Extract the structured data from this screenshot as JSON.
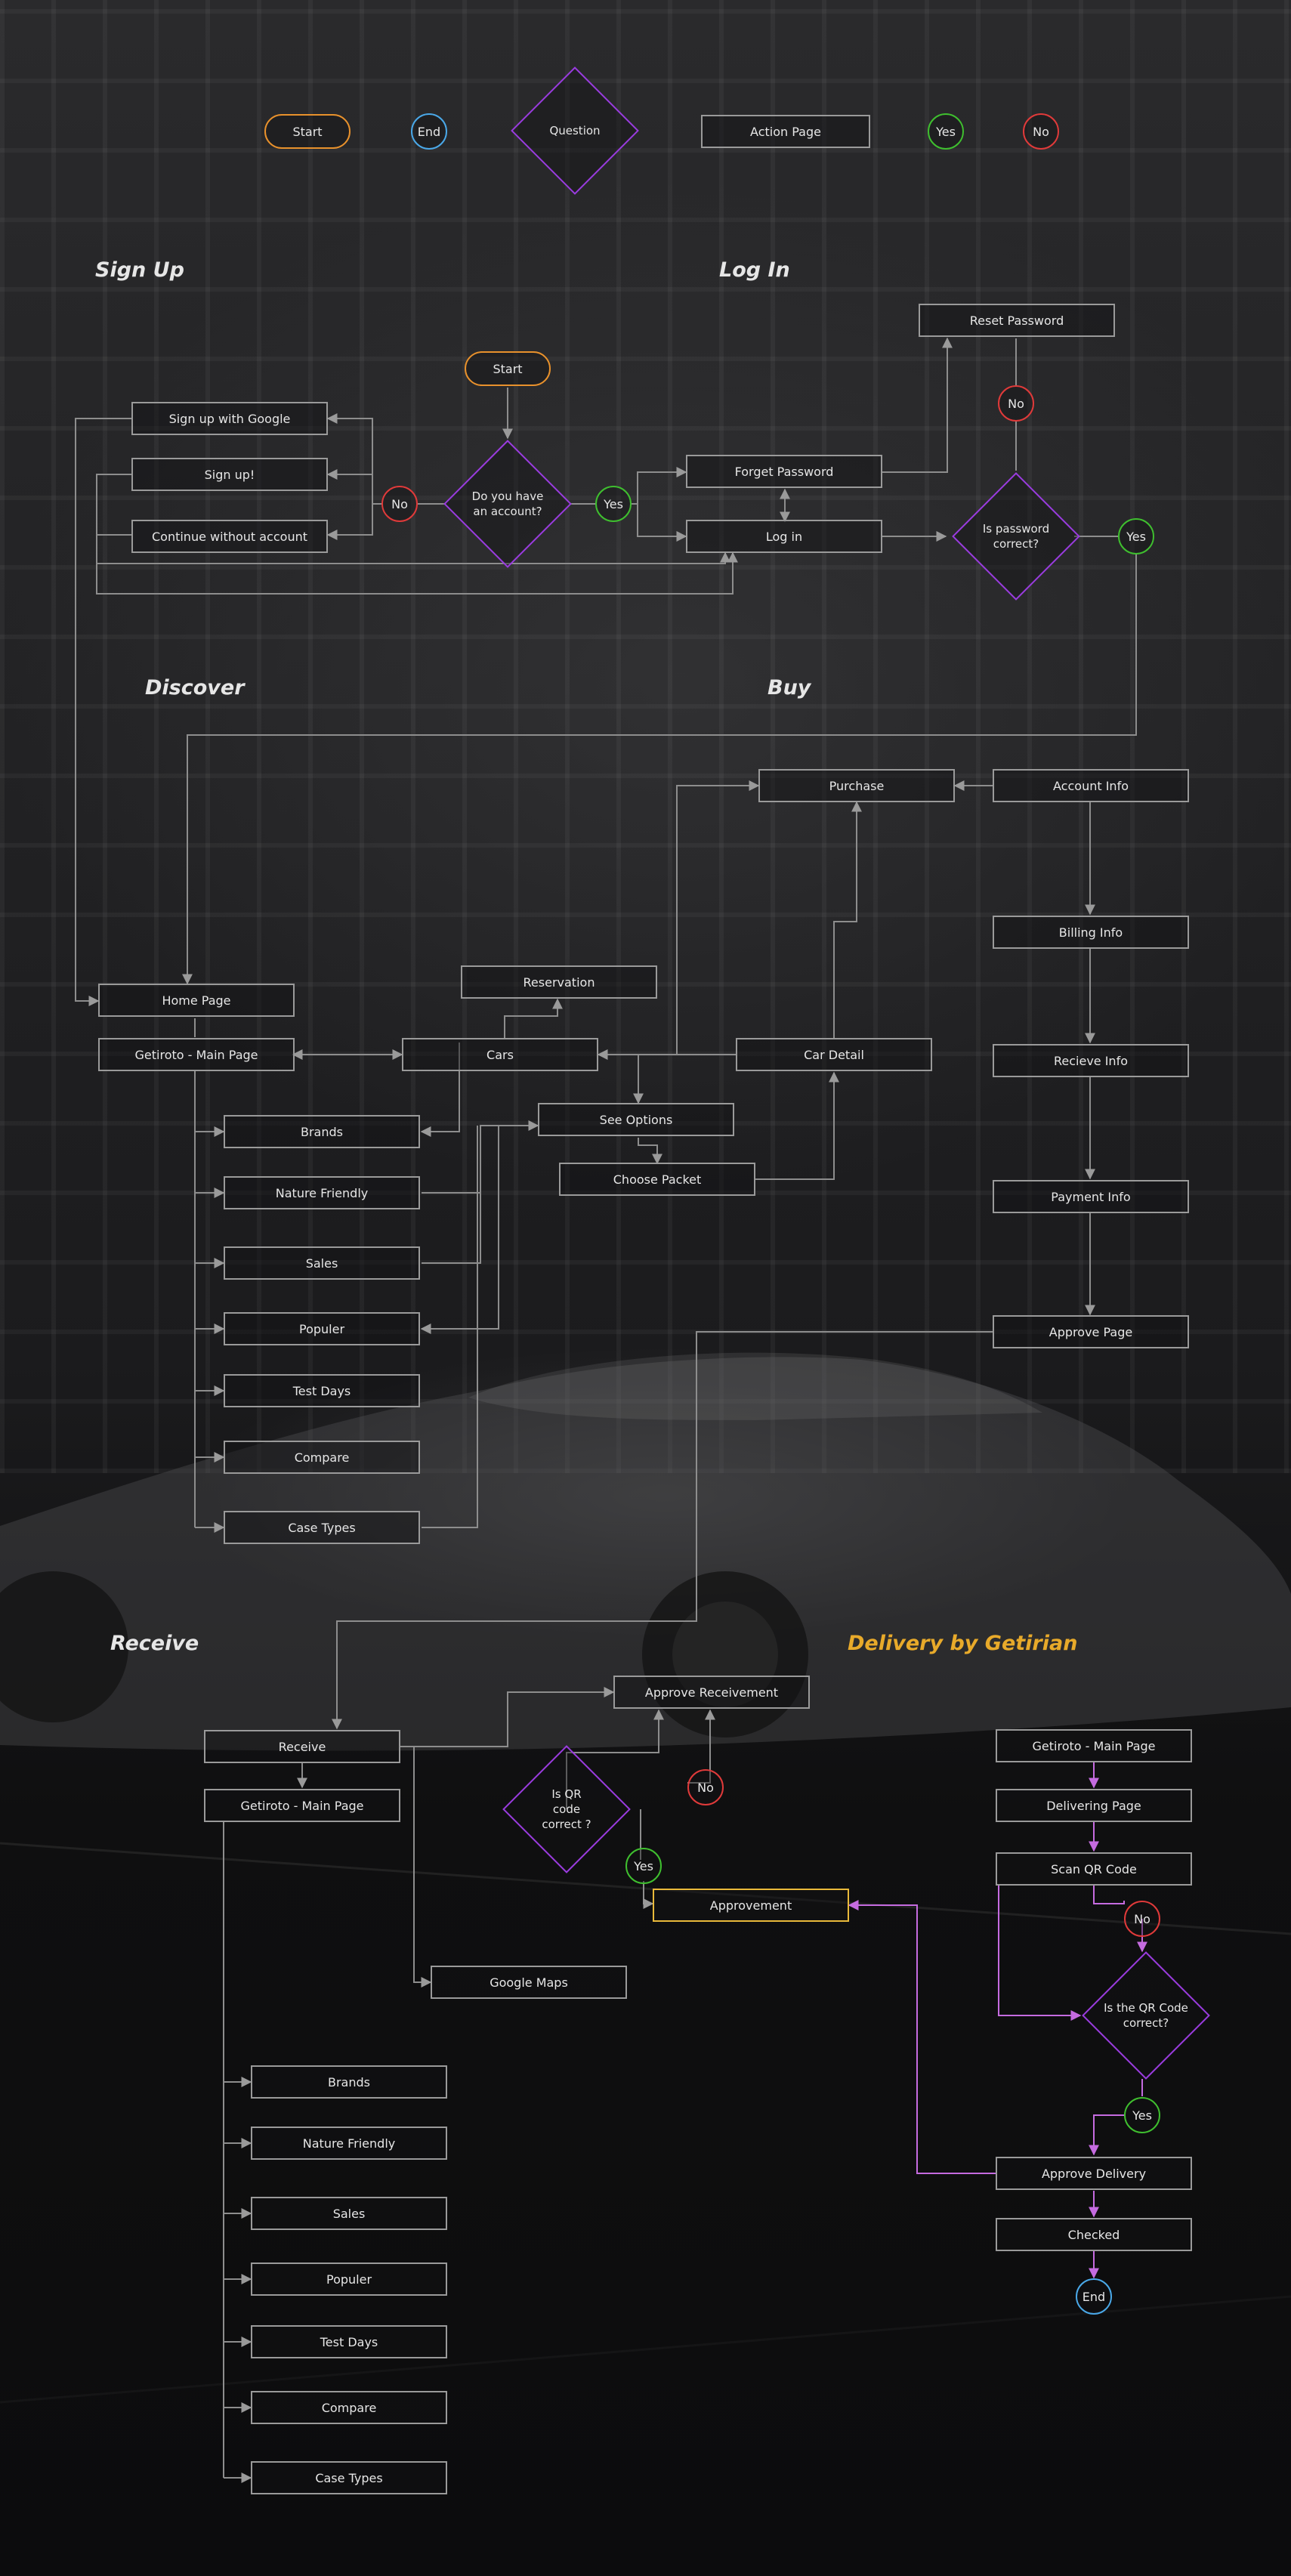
{
  "legend": {
    "start": "Start",
    "end": "End",
    "question": "Question",
    "action": "Action Page",
    "yes": "Yes",
    "no": "No"
  },
  "colors": {
    "start": "#e8912c",
    "end": "#4aa8e8",
    "question": "#9a3cdf",
    "yes": "#3fbf2f",
    "no": "#e03a3a",
    "highlight": "#e9b93a",
    "delivery_flow": "#c56be0",
    "connector": "#9a9a9a"
  },
  "sections": {
    "signup": "Sign Up",
    "login": "Log In",
    "discover": "Discover",
    "buy": "Buy",
    "receive": "Receive",
    "delivery": "Delivery by Getirian"
  },
  "auth": {
    "start": "Start",
    "question": "Do you have an account?",
    "no": "No",
    "yes": "Yes",
    "signup_google": "Sign up with Google",
    "signup": "Sign up!",
    "continue": "Continue without account",
    "forget": "Forget Password",
    "login": "Log in",
    "password_question": "Is password correct?",
    "reset": "Reset Password",
    "no2": "No",
    "yes2": "Yes"
  },
  "discover": {
    "home": "Home Page",
    "main": "Getiroto - Main Page",
    "cars": "Cars",
    "reservation": "Reservation",
    "see_options": "See Options",
    "choose_packet": "Choose Packet",
    "car_detail": "Car Detail",
    "list": [
      "Brands",
      "Nature Friendly",
      "Sales",
      "Populer",
      "Test Days",
      "Compare",
      "Case Types"
    ]
  },
  "buy": {
    "purchase": "Purchase",
    "account": "Account Info",
    "billing": "Billing Info",
    "recieve": "Recieve Info",
    "payment": "Payment Info",
    "approve": "Approve Page"
  },
  "receive": {
    "receive": "Receive",
    "main": "Getiroto - Main Page",
    "approve_receivement": "Approve Receivement",
    "qr_question": "Is QR code correct ?",
    "no": "No",
    "yes": "Yes",
    "approvement": "Approvement",
    "maps": "Google Maps",
    "list": [
      "Brands",
      "Nature Friendly",
      "Sales",
      "Populer",
      "Test Days",
      "Compare",
      "Case Types"
    ]
  },
  "delivery": {
    "main": "Getiroto - Main Page",
    "delivering": "Delivering Page",
    "scan": "Scan QR Code",
    "no": "No",
    "qr_question": "Is the QR Code correct?",
    "yes": "Yes",
    "approve": "Approve Delivery",
    "checked": "Checked",
    "end": "End"
  }
}
